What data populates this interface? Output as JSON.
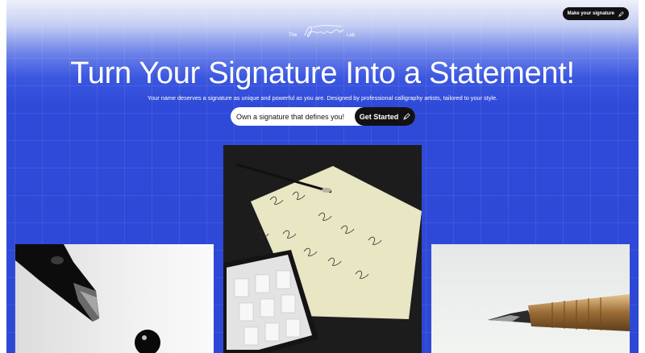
{
  "header": {
    "cta_label": "Make your signature",
    "cta_icon": "pencil-icon"
  },
  "logo": {
    "prefix": "The",
    "script": "Signature",
    "suffix": "Lab"
  },
  "hero": {
    "title": "Turn Your Signature Into a Statement!",
    "subtitle": "Your name deserves a signature as unique and powerful as you are. Designed by professional calligraphy artists, tailored to your style.",
    "cta_text": "Own a signature that defines you!",
    "cta_button": "Get Started",
    "cta_icon": "pencil-icon"
  },
  "colors": {
    "background": "#2e48d6",
    "button": "#121212",
    "text": "#ffffff"
  },
  "gallery": [
    {
      "name": "fountain-pen-ink-drop-photo"
    },
    {
      "name": "signature-practice-sheet-tablet-photo"
    },
    {
      "name": "gold-fountain-pen-photo"
    }
  ]
}
